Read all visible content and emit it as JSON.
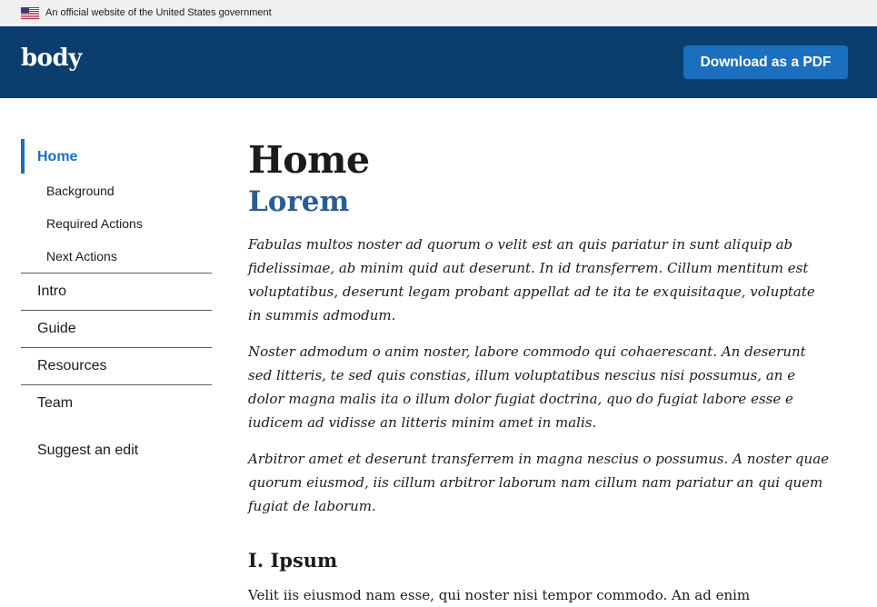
{
  "gov_banner": {
    "text": "An official website of the United States government"
  },
  "header": {
    "logo": "body",
    "pdf_button": "Download as a PDF"
  },
  "sidenav": {
    "current": "Home",
    "subitems": [
      "Background",
      "Required Actions",
      "Next Actions"
    ],
    "items": [
      "Intro",
      "Guide",
      "Resources",
      "Team"
    ],
    "suggest": "Suggest an edit"
  },
  "main": {
    "title": "Home",
    "subtitle": "Lorem",
    "paragraphs": [
      "Fabulas multos noster ad quorum o velit est an quis pariatur in sunt aliquip ab fidelissimae, ab minim quid aut deserunt. In id transferrem. Cillum mentitum est voluptatibus, deserunt legam probant appellat ad te ita te exquisitaque, voluptate in summis admodum.",
      "Noster admodum o anim noster, labore commodo qui cohaerescant. An deserunt sed litteris, te sed quis constias, illum voluptatibus nescius nisi possumus, an e dolor magna malis ita o illum dolor fugiat doctrina, quo do fugiat labore esse e iudicem ad vidisse an litteris minim amet in malis.",
      "Arbitror amet et deserunt transferrem in magna nescius o possumus. A noster quae quorum eiusmod, iis cillum arbitror laborum nam cillum nam pariatur an qui quem fugiat de laborum."
    ],
    "section_heading": "I. Ipsum",
    "section_text": "Velit iis eiusmod nam esse, qui noster nisi tempor commodo. An ad enim"
  }
}
